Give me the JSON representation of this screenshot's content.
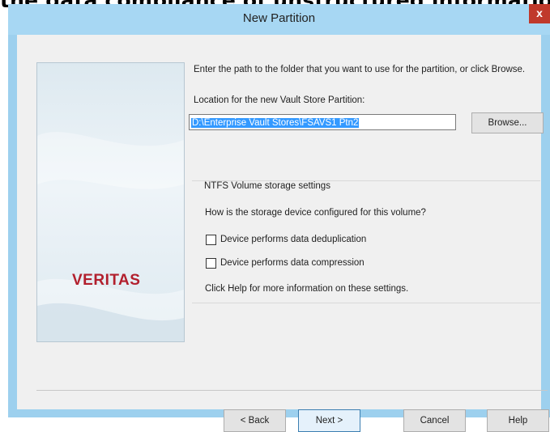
{
  "cutoff_text": "the data compliance of unstructured information.",
  "window": {
    "title": "New Partition",
    "close_label": "x"
  },
  "side_panel": {
    "logo_text": "VERITAS"
  },
  "form": {
    "intro_text": "Enter the path to the folder that you want to use for the partition, or click Browse.",
    "location_label": "Location for the new Vault Store Partition:",
    "location_value": "D:\\Enterprise Vault Stores\\FSAVS1 Ptn2",
    "browse_label": "Browse...",
    "group_title": "NTFS Volume storage settings",
    "question": "How is the storage device configured for this volume?",
    "options": [
      {
        "label": "Device performs data deduplication",
        "checked": false
      },
      {
        "label": "Device performs data compression",
        "checked": false
      }
    ],
    "help_note": "Click Help for more information on these settings."
  },
  "buttons": {
    "back": "< Back",
    "next": "Next >",
    "cancel": "Cancel",
    "help": "Help"
  }
}
